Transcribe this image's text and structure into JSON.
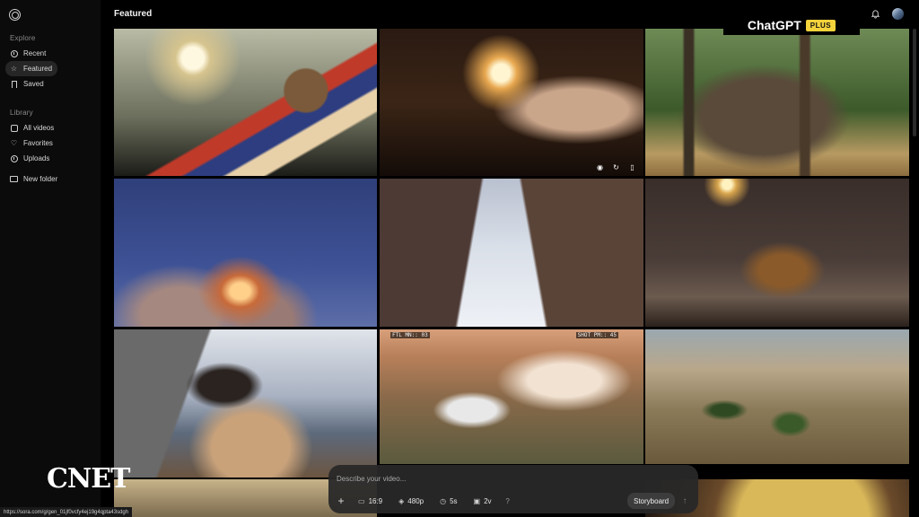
{
  "header": {
    "title": "Featured"
  },
  "brand_overlay": {
    "name": "ChatGPT",
    "tag": "PLUS"
  },
  "sidebar": {
    "explore_label": "Explore",
    "explore_items": [
      {
        "label": "Recent",
        "icon": "clock-icon"
      },
      {
        "label": "Featured",
        "icon": "star-icon",
        "active": true
      },
      {
        "label": "Saved",
        "icon": "bookmark-icon"
      }
    ],
    "library_label": "Library",
    "library_items": [
      {
        "label": "All videos",
        "icon": "grid-icon"
      },
      {
        "label": "Favorites",
        "icon": "heart-icon"
      },
      {
        "label": "Uploads",
        "icon": "upload-icon"
      }
    ],
    "new_folder": {
      "label": "New folder",
      "icon": "folder-plus-icon"
    }
  },
  "tiles": [
    {
      "id": "cat-lamp"
    },
    {
      "id": "old-man-lamp"
    },
    {
      "id": "piano-tree"
    },
    {
      "id": "rocket-launch"
    },
    {
      "id": "snowy-street"
    },
    {
      "id": "terrier-street"
    },
    {
      "id": "boy-rock"
    },
    {
      "id": "rv-desert",
      "film_left": "FTL MN:: 03",
      "film_right": "SHOT PM:: 45"
    },
    {
      "id": "savanna"
    },
    {
      "id": "balloon"
    },
    {
      "id": "coin"
    }
  ],
  "tile_actions": [
    "eye-icon",
    "refresh-icon",
    "bookmark-icon"
  ],
  "prompt": {
    "placeholder": "Describe your video...",
    "aspect": "16:9",
    "resolution": "480p",
    "duration": "5s",
    "variations": "2v",
    "help": "?",
    "storyboard": "Storyboard",
    "submit_icon": "arrow-up-icon"
  },
  "status_url": "https://sora.com/g/gen_01jf0vcfy4ej19g4qpta43sdgh",
  "watermark": "CNET"
}
